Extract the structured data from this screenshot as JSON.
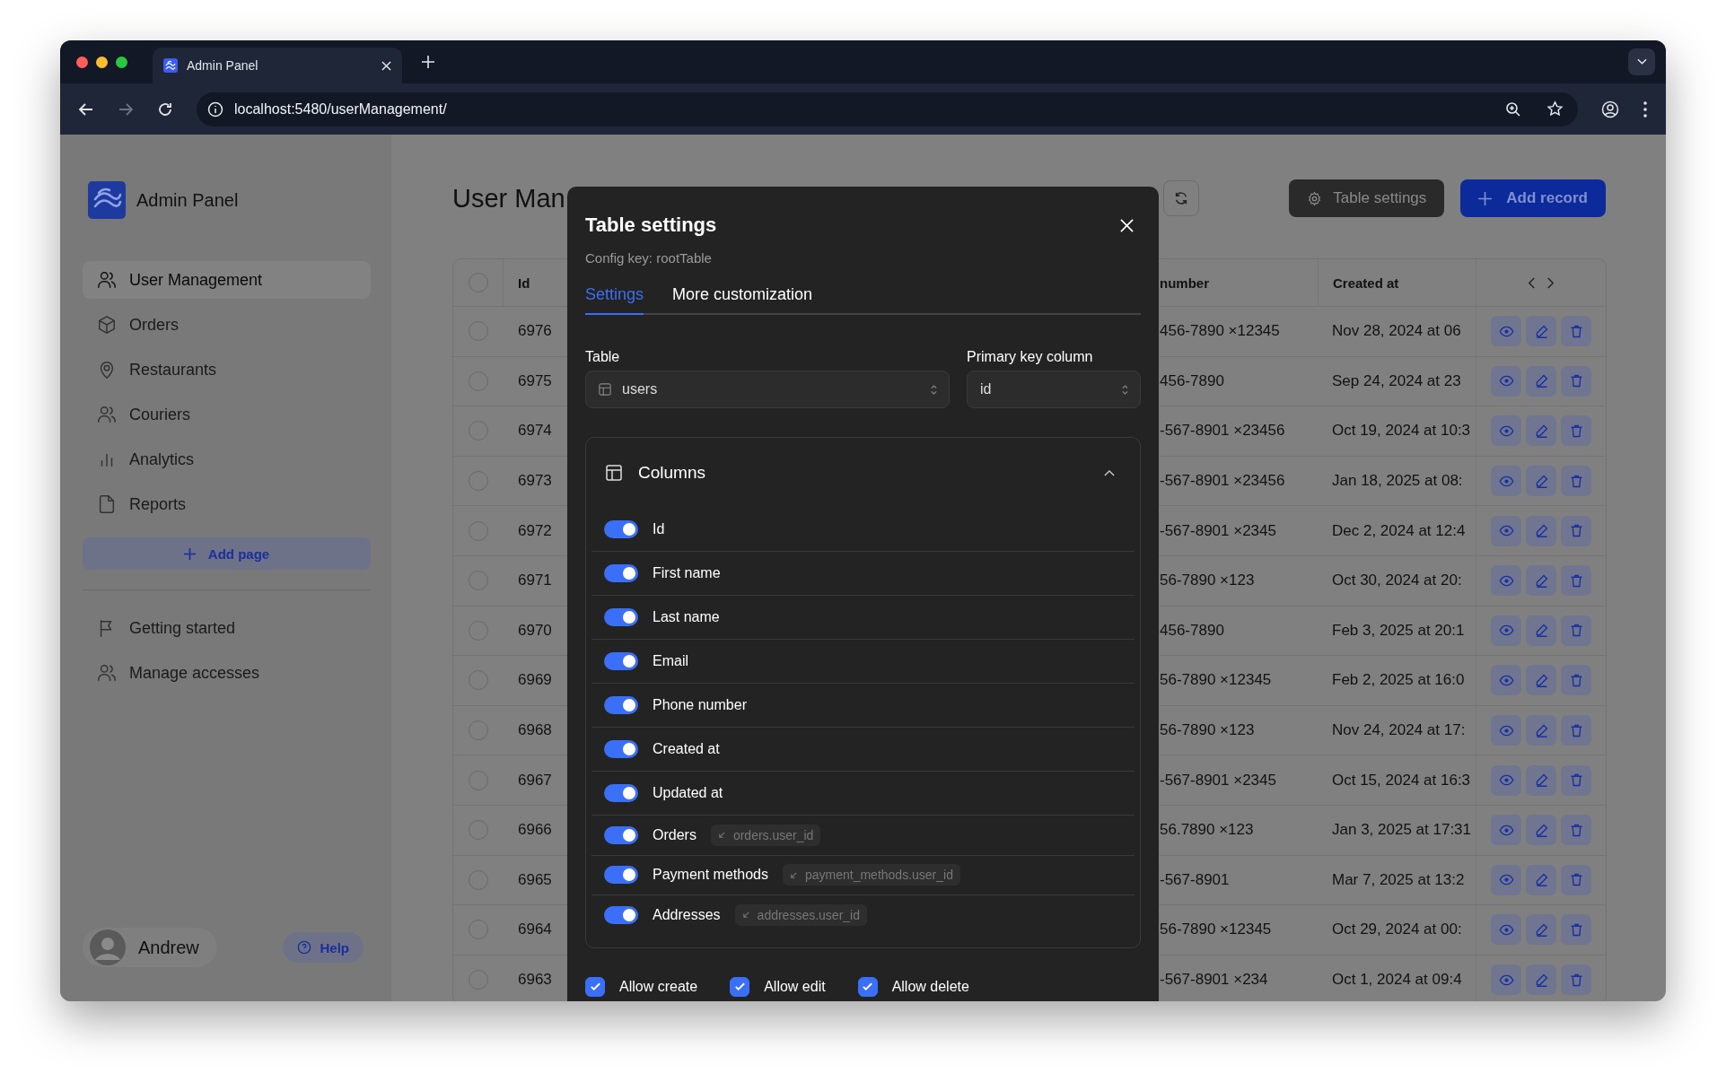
{
  "browser": {
    "tab": {
      "title": "Admin Panel"
    },
    "url": "localhost:5480/userManagement/"
  },
  "sidebar": {
    "app_name": "Admin Panel",
    "nav": [
      {
        "label": "User Management",
        "selected": true
      },
      {
        "label": "Orders",
        "selected": false
      },
      {
        "label": "Restaurants",
        "selected": false
      },
      {
        "label": "Couriers",
        "selected": false
      },
      {
        "label": "Analytics",
        "selected": false
      },
      {
        "label": "Reports",
        "selected": false
      }
    ],
    "add_page": "Add page",
    "secondary": [
      {
        "label": "Getting started"
      },
      {
        "label": "Manage accesses"
      }
    ],
    "user": {
      "name": "Andrew"
    },
    "help": "Help"
  },
  "page": {
    "title": "User Man",
    "table_settings": "Table settings",
    "add_record": "Add record"
  },
  "table": {
    "select_all": {
      "checked": false
    },
    "columns": [
      {
        "label": "Id"
      },
      {
        "label": "number"
      },
      {
        "label": "Created at"
      }
    ],
    "rows": [
      {
        "id": "6976",
        "phone": "456-7890 ×12345",
        "created": "Nov 28, 2024 at 06",
        "checked": false
      },
      {
        "id": "6975",
        "phone": "456-7890",
        "created": "Sep 24, 2024 at 23",
        "checked": false
      },
      {
        "id": "6974",
        "phone": "-567-8901 ×23456",
        "created": "Oct 19, 2024 at 10:3",
        "checked": false
      },
      {
        "id": "6973",
        "phone": "-567-8901 ×23456",
        "created": "Jan 18, 2025 at 08:",
        "checked": false
      },
      {
        "id": "6972",
        "phone": "-567-8901 ×2345",
        "created": "Dec 2, 2024 at 12:4",
        "checked": false
      },
      {
        "id": "6971",
        "phone": "56-7890 ×123",
        "created": "Oct 30, 2024 at 20:",
        "checked": false
      },
      {
        "id": "6970",
        "phone": "456-7890",
        "created": "Feb 3, 2025 at 20:1",
        "checked": false
      },
      {
        "id": "6969",
        "phone": "56-7890 ×12345",
        "created": "Feb 2, 2025 at 16:0",
        "checked": false
      },
      {
        "id": "6968",
        "phone": "56-7890 ×123",
        "created": "Nov 24, 2024 at 17:",
        "checked": false
      },
      {
        "id": "6967",
        "phone": "-567-8901 ×2345",
        "created": "Oct 15, 2024 at 16:3",
        "checked": false
      },
      {
        "id": "6966",
        "phone": "56.7890 ×123",
        "created": "Jan 3, 2025 at 17:31",
        "checked": false
      },
      {
        "id": "6965",
        "phone": "-567-8901",
        "created": "Mar 7, 2025 at 13:2",
        "checked": false
      },
      {
        "id": "6964",
        "phone": "56-7890 ×12345",
        "created": "Oct 29, 2024 at 00:",
        "checked": false
      },
      {
        "id": "6963",
        "phone": "-567-8901 ×234",
        "created": "Oct 1, 2024 at 09:4",
        "checked": false
      }
    ]
  },
  "modal": {
    "title": "Table settings",
    "subtitle": "Config key: rootTable",
    "tabs": [
      {
        "label": "Settings",
        "selected": true
      },
      {
        "label": "More customization",
        "selected": false
      }
    ],
    "table_field": {
      "label": "Table",
      "value": "users"
    },
    "pk_field": {
      "label": "Primary key column",
      "value": "id"
    },
    "columns": {
      "title": "Columns",
      "expanded": true,
      "items": [
        {
          "label": "Id",
          "on": true
        },
        {
          "label": "First name",
          "on": true
        },
        {
          "label": "Last name",
          "on": true
        },
        {
          "label": "Email",
          "on": true
        },
        {
          "label": "Phone number",
          "on": true
        },
        {
          "label": "Created at",
          "on": true
        },
        {
          "label": "Updated at",
          "on": true
        },
        {
          "label": "Orders",
          "on": true,
          "relation": "orders.user_id"
        },
        {
          "label": "Payment methods",
          "on": true,
          "relation": "payment_methods.user_id"
        },
        {
          "label": "Addresses",
          "on": true,
          "relation": "addresses.user_id"
        }
      ]
    },
    "permissions": [
      {
        "label": "Allow create",
        "checked": true
      },
      {
        "label": "Allow edit",
        "checked": true
      },
      {
        "label": "Allow delete",
        "checked": true
      }
    ]
  }
}
